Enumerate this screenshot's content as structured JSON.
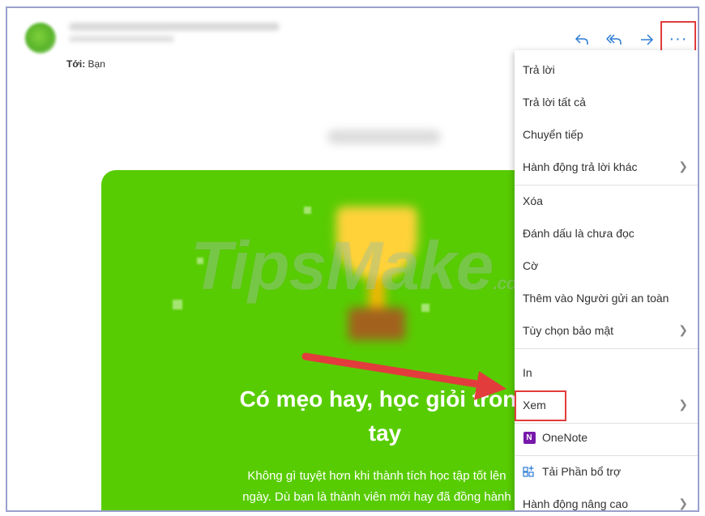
{
  "header": {
    "to_label": "Tới:",
    "to_value": "Bạn"
  },
  "toolbar": {
    "reply_icon": "reply-icon",
    "reply_all_icon": "reply-all-icon",
    "forward_icon": "forward-icon",
    "more_label": "···"
  },
  "email": {
    "watermark": "TipsMake",
    "watermark_domain": ".com",
    "headline_line1": "Có mẹo hay, học giỏi trong",
    "headline_line2": "tay",
    "para_line1": "Không gì tuyệt hơn khi thành tích học tập tốt lên",
    "para_line2": "ngày. Dù bạn là thành viên mới hay đã đồng hành"
  },
  "menu": {
    "items": [
      {
        "label": "Trả lời"
      },
      {
        "label": "Trả lời tất cả"
      },
      {
        "label": "Chuyển tiếp"
      },
      {
        "label": "Hành động trả lời khác"
      },
      {
        "label": "Xóa"
      },
      {
        "label": "Đánh dấu là chưa đọc"
      },
      {
        "label": "Cờ"
      },
      {
        "label": "Thêm vào Người gửi an toàn"
      },
      {
        "label": "Tùy chọn bảo mật"
      },
      {
        "label": "In"
      },
      {
        "label": "Xem"
      },
      {
        "label": "OneNote"
      },
      {
        "label": "Tải Phần bổ trợ"
      },
      {
        "label": "Hành động nâng cao"
      }
    ],
    "onenote_icon_letter": "N"
  },
  "colors": {
    "accent": "#2b7cd3",
    "highlight": "#e23c3c",
    "email_green": "#58cc02"
  }
}
